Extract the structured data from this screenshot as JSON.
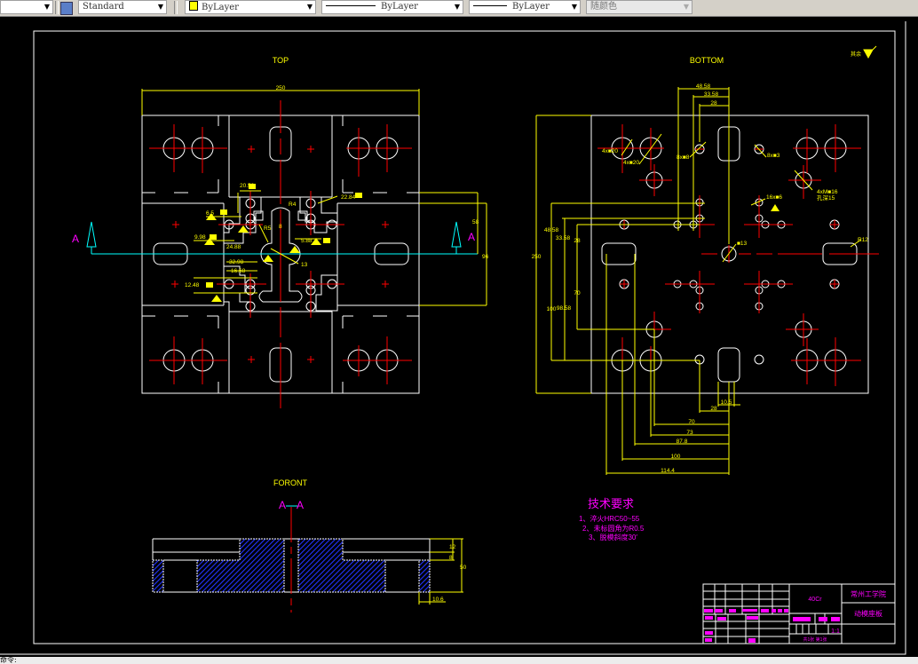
{
  "toolbar": {
    "text_style": "Standard",
    "layer_color": "ByLayer",
    "linetype": "ByLayer",
    "lineweight": "ByLayer",
    "plot_style": "随颜色"
  },
  "colors": {
    "background": "#000000",
    "outline": "#ffffff",
    "centerline": "#ff0000",
    "dimension": "#ffff00",
    "section": "#00ffff",
    "annotation": "#ff00ff",
    "hatch": "#0000ff"
  },
  "views": {
    "top": {
      "title": "TOP",
      "section_label": "A",
      "dims": [
        "250",
        "20.58",
        "6.5",
        "9.98",
        "24.88",
        "32.98",
        "16.68",
        "12.48",
        "22.84",
        "5.88",
        "R4",
        "R5",
        "8",
        "13",
        "58",
        "96"
      ]
    },
    "bottom": {
      "title": "BOTTOM",
      "roughness": "其余",
      "dims_top": [
        "48.58",
        "33.58",
        "28"
      ],
      "dims_left": [
        "250",
        "48.58",
        "33.58",
        "28",
        "70",
        "100",
        "98.58"
      ],
      "dims_bottom": [
        "10.5",
        "28",
        "70",
        "73",
        "87.8",
        "100",
        "114.4"
      ],
      "callouts": [
        "4x■20",
        "4x■20",
        "8x■8",
        "8x■3",
        "16x■6",
        "4xM■16",
        "孔深15",
        "■13",
        "R12"
      ]
    },
    "front": {
      "title": "FORONT",
      "section_label": "A—A",
      "dims": [
        "12",
        "8",
        "50",
        "10.6"
      ]
    }
  },
  "requirements": {
    "title": "技术要求",
    "items": [
      "1、淬火HRC50~55",
      "2、未标圆角为R0.5",
      "3、脱模斜度30′"
    ]
  },
  "title_block": {
    "material": "40Cr",
    "school": "常州工学院",
    "part_name": "动模座板",
    "scale": "1:1",
    "sheets": "共1张 第1张"
  },
  "status": {
    "command": "命令:"
  }
}
